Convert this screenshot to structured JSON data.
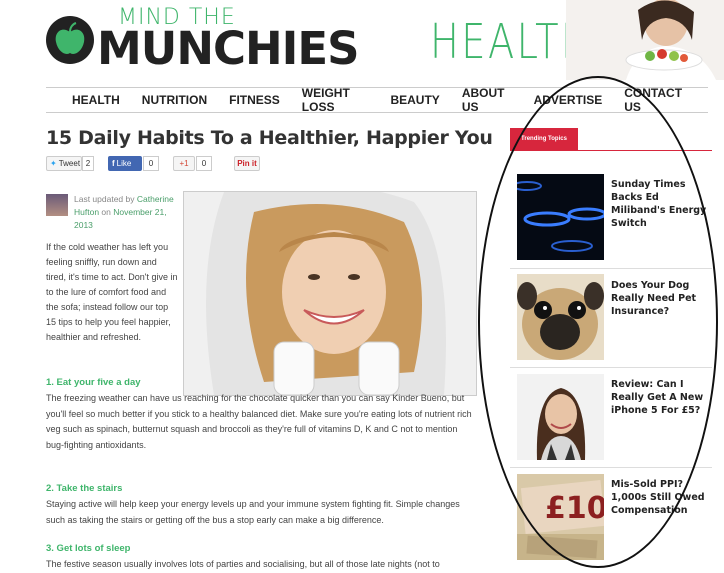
{
  "header": {
    "logo_top": "MIND THE",
    "logo_main": "MUNCHIES",
    "section": "HEALTH"
  },
  "nav": [
    "HEALTH",
    "NUTRITION",
    "FITNESS",
    "WEIGHT LOSS",
    "BEAUTY",
    "ABOUT US",
    "ADVERTISE",
    "CONTACT US"
  ],
  "article": {
    "title": "15 Daily Habits To a Healthier, Happier You",
    "share": {
      "tweet": "Tweet",
      "tweet_count": "2",
      "like": "Like",
      "like_count": "0",
      "gplus": "+1",
      "gplus_count": "0",
      "pin": "Pin it"
    },
    "byline_pre": "Last updated by ",
    "byline_author": "Catherine Hufton",
    "byline_mid": " on ",
    "byline_date": "November 21, 2013",
    "lead": "If the cold weather has left you feeling sniffly, run down and tired, it's time to act. Don't give in to the lure of comfort food and the sofa; instead follow our top 15 tips to help you feel happier, healthier and refreshed.",
    "sections": [
      {
        "heading": "1. Eat your five a day",
        "text": "The freezing weather can have us reaching for the chocolate quicker than you can say Kinder Bueno, but you'll feel so much better if you stick to a healthy balanced diet. Make sure you're eating lots of nutrient rich veg such as spinach, butternut squash and broccoli as they're full of vitamins D, K and C not to mention bug-fighting antioxidants."
      },
      {
        "heading": "2. Take the stairs",
        "text": "Staying active will help keep your energy levels up and your immune system fighting fit. Simple changes such as taking the stairs or getting off the bus a stop early can make a big difference."
      },
      {
        "heading": "3. Get lots of sleep",
        "text": "The festive season usually involves lots of parties and socialising, but all of those late nights (not to"
      }
    ]
  },
  "sidebar": {
    "tab": "Trending Topics",
    "items": [
      {
        "title": "Sunday Times Backs Ed Miliband's Energy Switch"
      },
      {
        "title": "Does Your Dog Really Need Pet Insurance?"
      },
      {
        "title": "Review: Can I Really Get A New iPhone 5 For £5?"
      },
      {
        "title": "Mis-Sold PPI? 1,000s Still Owed Compensation"
      }
    ]
  },
  "colors": {
    "brand_green": "#3fb56b",
    "trend_red": "#d7263d"
  }
}
